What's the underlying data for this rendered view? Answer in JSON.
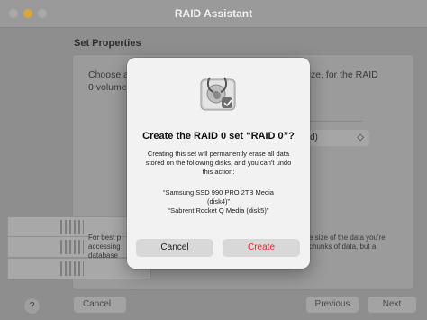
{
  "window": {
    "title": "RAID Assistant",
    "section_title": "Set Properties",
    "description": "Choose a name, format and chunk size, for the RAID 0 volume",
    "description_visible_left": "Choose a",
    "description_visible_left2": "0 volume",
    "description_visible_right": ") size, for the RAID",
    "popup_value": "d)",
    "popup_chevron": "◇",
    "footer_left": [
      "For best p",
      "accessing",
      "database"
    ],
    "footer_right": [
      "e size of the data you're",
      "chunks of data, but a"
    ],
    "bottom": {
      "help": "?",
      "cancel": "Cancel",
      "previous": "Previous",
      "next": "Next"
    }
  },
  "dialog": {
    "icon": "disk-utility-icon",
    "title": "Create the RAID 0 set “RAID 0”?",
    "body": "Creating this set will permanently erase all data stored on the following disks, and you can't undo this action:",
    "disks": [
      "“Samsung SSD 990 PRO 2TB Media",
      "(disk4)”",
      "“Sabrent Rocket Q Media (disk5)”"
    ],
    "cancel_label": "Cancel",
    "create_label": "Create",
    "create_color": "#e02b2b"
  }
}
